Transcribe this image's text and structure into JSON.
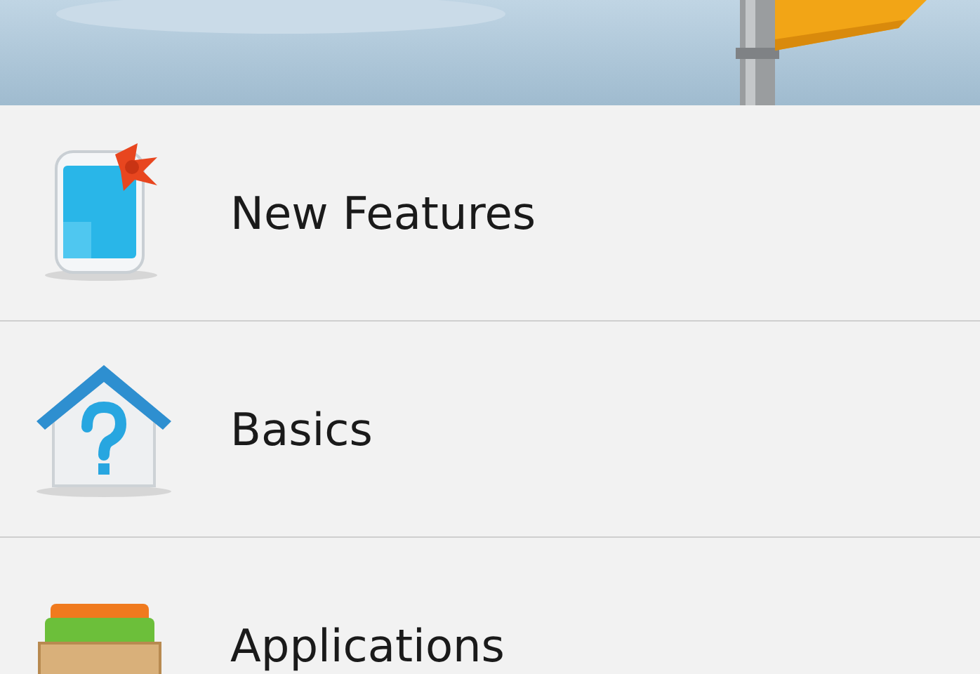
{
  "items": [
    {
      "label": "New Features",
      "kind": "phone"
    },
    {
      "label": "Basics",
      "kind": "house"
    },
    {
      "label": "Applications",
      "kind": "box"
    }
  ]
}
